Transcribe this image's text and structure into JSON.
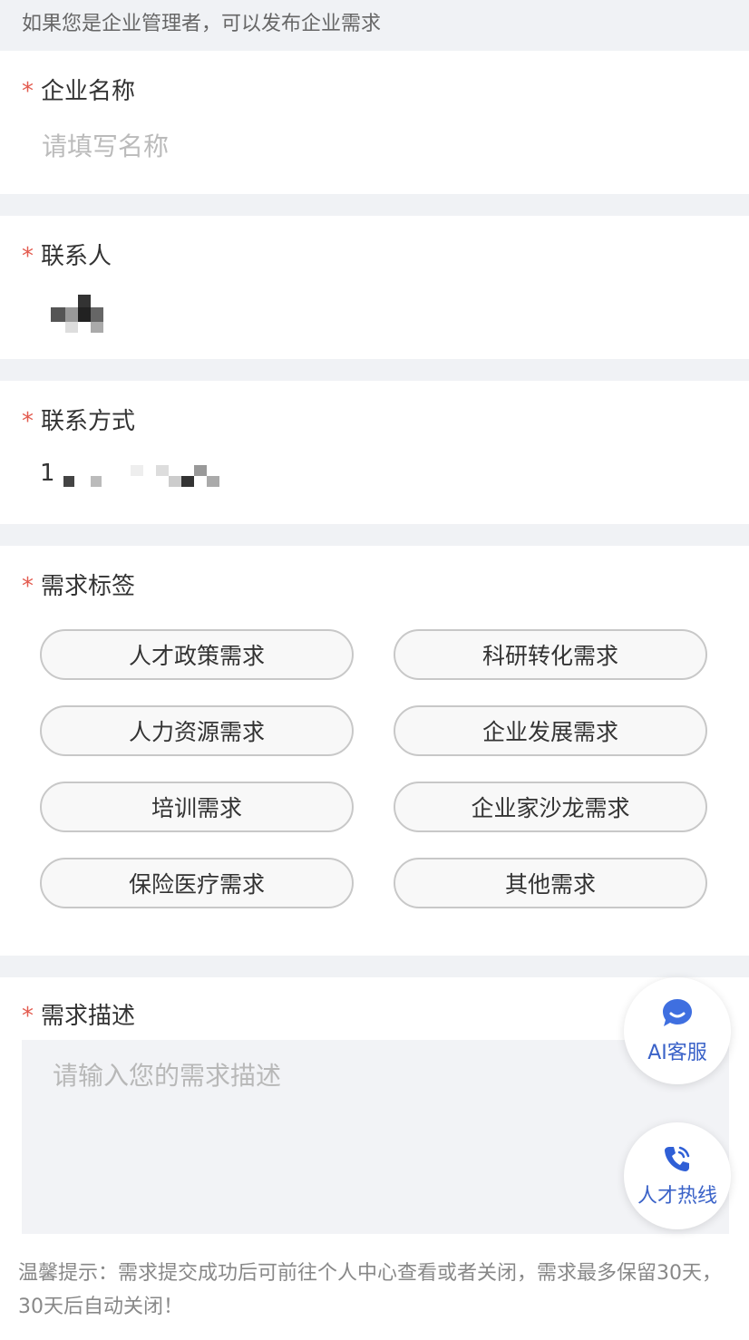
{
  "notice": "如果您是企业管理者，可以发布企业需求",
  "fields": {
    "company": {
      "label": "企业名称",
      "placeholder": "请填写名称"
    },
    "contact": {
      "label": "联系人",
      "value_masked": true
    },
    "phone": {
      "label": "联系方式",
      "value_prefix": "1",
      "value_masked": true
    }
  },
  "tags": {
    "label": "需求标签",
    "items": [
      "人才政策需求",
      "科研转化需求",
      "人力资源需求",
      "企业发展需求",
      "培训需求",
      "企业家沙龙需求",
      "保险医疗需求",
      "其他需求"
    ]
  },
  "description": {
    "label": "需求描述",
    "placeholder": "请输入您的需求描述"
  },
  "tip": "温馨提示：需求提交成功后可前往个人中心查看或者关闭，需求最多保留30天，30天后自动关闭！",
  "floating": {
    "ai_service": {
      "label": "AI客服",
      "icon": "chat-bubble-icon"
    },
    "hotline": {
      "label": "人才热线",
      "icon": "phone-icon"
    }
  },
  "colors": {
    "required_star": "#e35b4f",
    "accent": "#3a62c8",
    "page_bg": "#f0f2f5"
  }
}
